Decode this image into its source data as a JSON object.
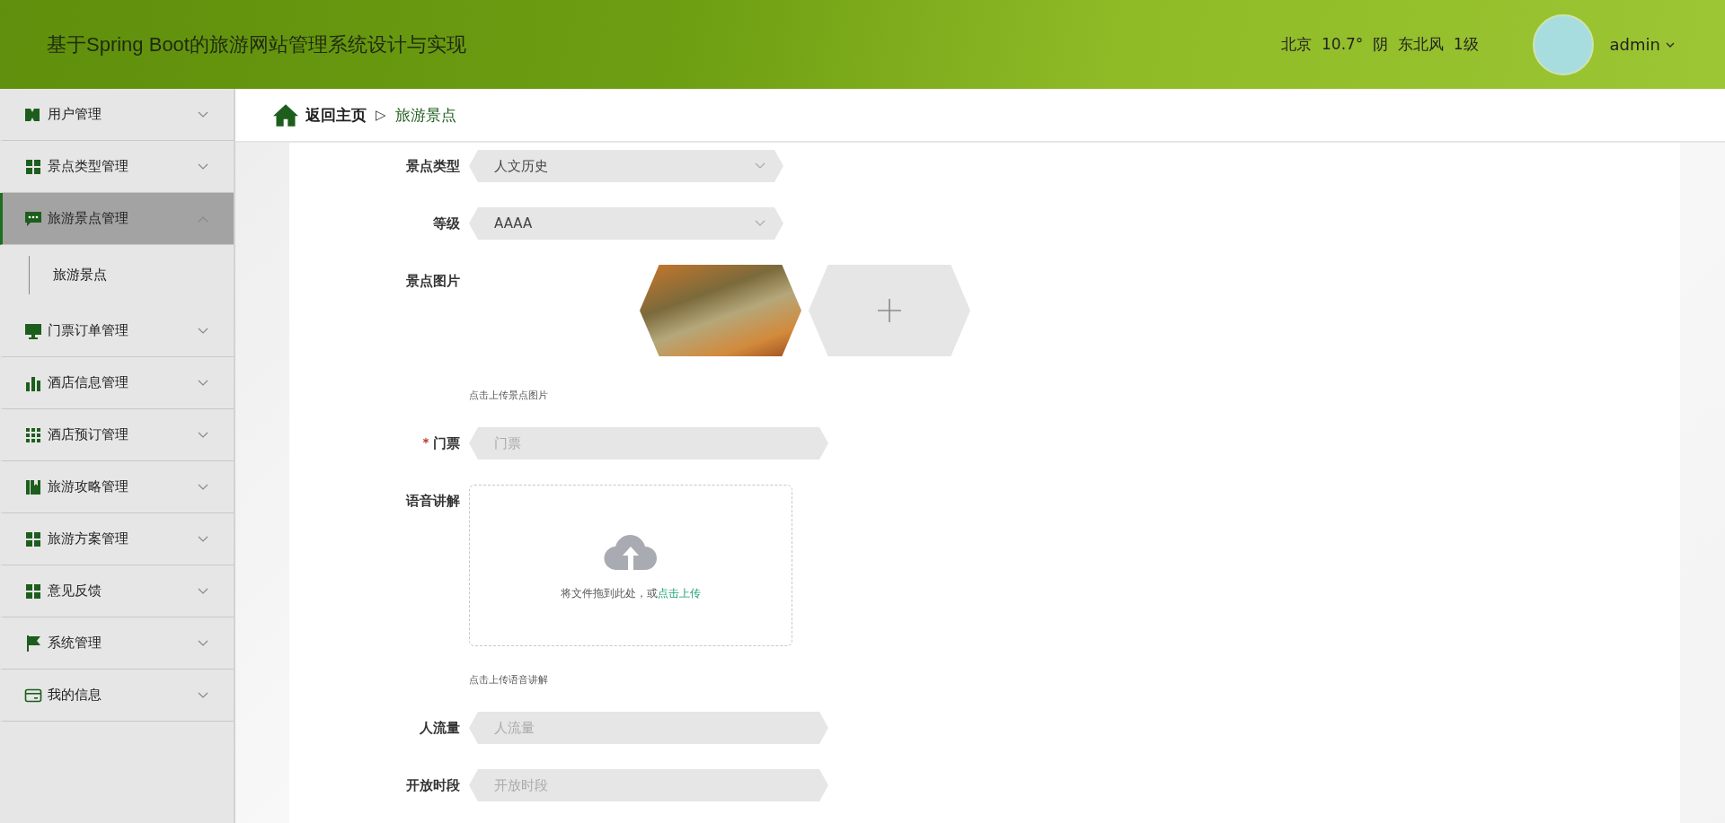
{
  "header": {
    "title": "基于Spring Boot的旅游网站管理系统设计与实现",
    "weather": "北京  10.7°  阴  东北风  1级",
    "user": "admin"
  },
  "sidebar": {
    "items": [
      {
        "label": "用户管理",
        "expanded": false,
        "selected": false
      },
      {
        "label": "景点类型管理",
        "expanded": false,
        "selected": false
      },
      {
        "label": "旅游景点管理",
        "expanded": true,
        "selected": true,
        "children": [
          {
            "label": "旅游景点",
            "selected": false
          }
        ]
      },
      {
        "label": "门票订单管理",
        "expanded": false,
        "selected": false
      },
      {
        "label": "酒店信息管理",
        "expanded": false,
        "selected": false
      },
      {
        "label": "酒店预订管理",
        "expanded": false,
        "selected": false
      },
      {
        "label": "旅游攻略管理",
        "expanded": false,
        "selected": false
      },
      {
        "label": "旅游方案管理",
        "expanded": false,
        "selected": false
      },
      {
        "label": "意见反馈",
        "expanded": false,
        "selected": false
      },
      {
        "label": "系统管理",
        "expanded": false,
        "selected": false
      },
      {
        "label": "我的信息",
        "expanded": false,
        "selected": false
      }
    ]
  },
  "breadcrumb": {
    "home": "返回主页",
    "separator": "▷",
    "current": "旅游景点"
  },
  "form": {
    "fields": [
      {
        "kind": "select",
        "label": "景点类型",
        "value": "人文历史",
        "required": false
      },
      {
        "kind": "select",
        "label": "等级",
        "value": "AAAA",
        "required": false
      },
      {
        "kind": "image",
        "label": "景点图片",
        "hint": "点击上传景点图片",
        "required": false
      },
      {
        "kind": "input",
        "label": "门票",
        "placeholder": "门票",
        "required": true
      },
      {
        "kind": "file",
        "label": "语音讲解",
        "drop_text": "将文件拖到此处，或",
        "link": "点击上传",
        "hint": "点击上传语音讲解",
        "required": false
      },
      {
        "kind": "input",
        "label": "人流量",
        "placeholder": "人流量",
        "required": false
      },
      {
        "kind": "input",
        "label": "开放时段",
        "placeholder": "开放时段",
        "required": false
      }
    ]
  }
}
